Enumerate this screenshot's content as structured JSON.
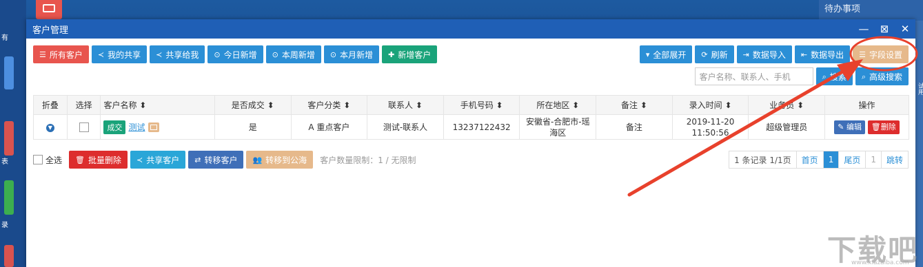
{
  "desktop": {
    "todo_label": "待办事项",
    "left_letters": [
      "有",
      "表",
      "录"
    ],
    "edge_letter": "试用"
  },
  "window": {
    "title": "客户管理"
  },
  "toolbar_left": [
    {
      "label": "所有客户",
      "icon": "list-icon",
      "glyph": "☰",
      "color": "red"
    },
    {
      "label": "我的共享",
      "icon": "share-icon",
      "glyph": "≺",
      "color": "blue"
    },
    {
      "label": "共享给我",
      "icon": "share-icon",
      "glyph": "≺",
      "color": "blue"
    },
    {
      "label": "今日新增",
      "icon": "clock-icon",
      "glyph": "⊙",
      "color": "blue"
    },
    {
      "label": "本周新增",
      "icon": "clock-icon",
      "glyph": "⊙",
      "color": "blue"
    },
    {
      "label": "本月新增",
      "icon": "clock-icon",
      "glyph": "⊙",
      "color": "blue"
    },
    {
      "label": "新增客户",
      "icon": "plus-icon",
      "glyph": "✚",
      "color": "green"
    }
  ],
  "toolbar_right": [
    {
      "label": "全部展开",
      "icon": "caret-down-icon",
      "glyph": "▾"
    },
    {
      "label": "刷新",
      "icon": "refresh-icon",
      "glyph": "⟳"
    },
    {
      "label": "数据导入",
      "icon": "import-icon",
      "glyph": "⇥"
    },
    {
      "label": "数据导出",
      "icon": "export-icon",
      "glyph": "⇤"
    },
    {
      "label": "字段设置",
      "icon": "list-icon",
      "glyph": "☰"
    }
  ],
  "search": {
    "placeholder": "客户名称、联系人、手机",
    "search_label": "搜索",
    "advanced_label": "高级搜索"
  },
  "table": {
    "headers": [
      "折叠",
      "选择",
      "客户名称",
      "是否成交",
      "客户分类",
      "联系人",
      "手机号码",
      "所在地区",
      "备注",
      "录入时间",
      "业务员",
      "操作"
    ],
    "rows": [
      {
        "deal_tag": "成交",
        "name": "测试",
        "is_deal": "是",
        "category": "A 重点客户",
        "contact": "测试-联系人",
        "phone": "13237122432",
        "region": "安徽省-合肥市-瑶海区",
        "remark": "备注",
        "date": "2019-11-20",
        "time": "11:50:56",
        "salesperson": "超级管理员",
        "edit_label": "编辑",
        "delete_label": "删除"
      }
    ]
  },
  "bottom": {
    "select_all": "全选",
    "batch_delete": "批量删除",
    "share_customer": "共享客户",
    "transfer_customer": "转移客户",
    "move_to_public": "转移到公海",
    "limit_text": "客户数量限制：1 / 无限制"
  },
  "pager": {
    "summary": "1 条记录 1/1页",
    "first": "首页",
    "current": "1",
    "last": "尾页",
    "page_box": "1",
    "jump": "跳转"
  },
  "colors": {
    "titlebar": "#1f5fb6",
    "accent_blue": "#2b8fd6",
    "red": "#e8554e",
    "green": "#1aa37a",
    "annotation": "#e8412c"
  },
  "watermark": {
    "brand": "下载吧",
    "url": "www.xiazaiba.com"
  }
}
